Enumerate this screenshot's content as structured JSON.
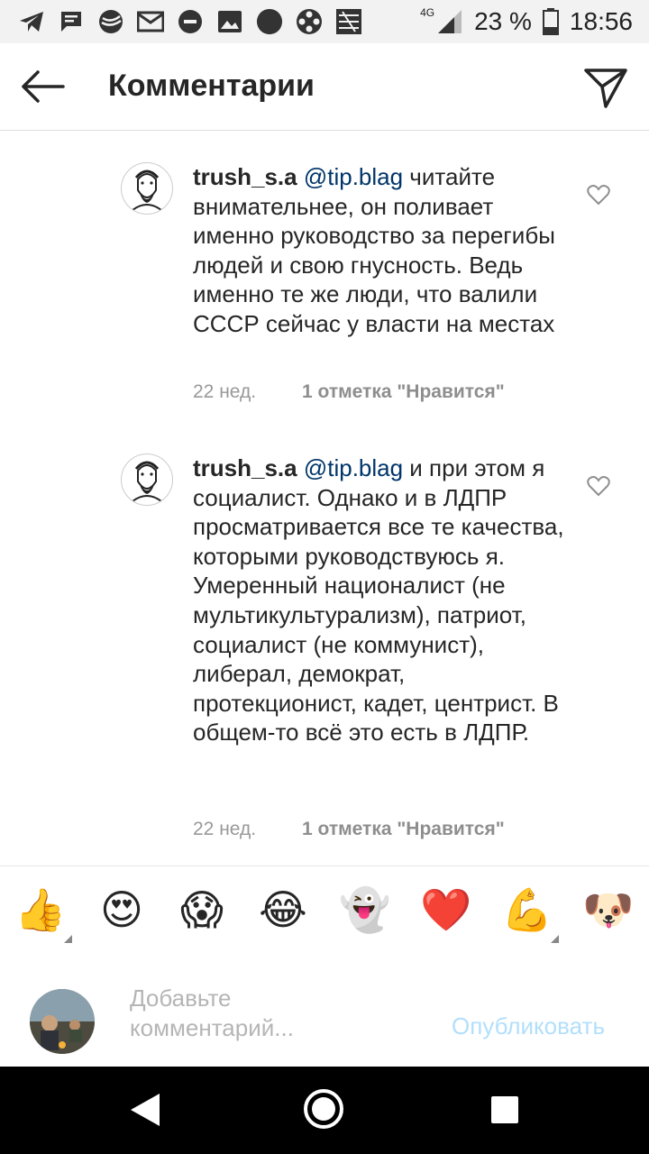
{
  "status_bar": {
    "network": "4G",
    "battery": "23 %",
    "time": "18:56",
    "notification_icons": [
      "telegram-icon",
      "message-icon",
      "sberbank-icon",
      "mail-icon",
      "dnd-icon",
      "gallery-icon",
      "circle-icon",
      "film-icon",
      "app-icon"
    ]
  },
  "header": {
    "title": "Комментарии"
  },
  "comments": [
    {
      "username": "trush_s.a",
      "mention": "@tip.blag",
      "text": " читайте внимательнее, он поливает именно руководство за перегибы людей и свою гнусность. Ведь именно те же люди, что валили СССР сейчас у власти на местах",
      "age": "22 нед.",
      "likes": "1 отметка \"Нравится\""
    },
    {
      "username": "trush_s.a",
      "mention": "@tip.blag",
      "text": " и при этом я социалист. Однако и в ЛДПР просматривается все те качества, которыми руководствуюсь я. Умеренный националист (не мультикультурализм), патриот, социалист (не коммунист), либерал, демократ, протекционист, кадет, центрист. В общем-то всё это есть в ЛДПР.",
      "age": "22 нед.",
      "likes": "1 отметка \"Нравится\""
    }
  ],
  "emoji_bar": [
    "👍",
    "😍",
    "😱",
    "😂",
    "👻",
    "❤️",
    "💪",
    "🐶"
  ],
  "comment_input": {
    "placeholder": "Добавьте комментарий...",
    "publish_label": "Опубликовать"
  }
}
